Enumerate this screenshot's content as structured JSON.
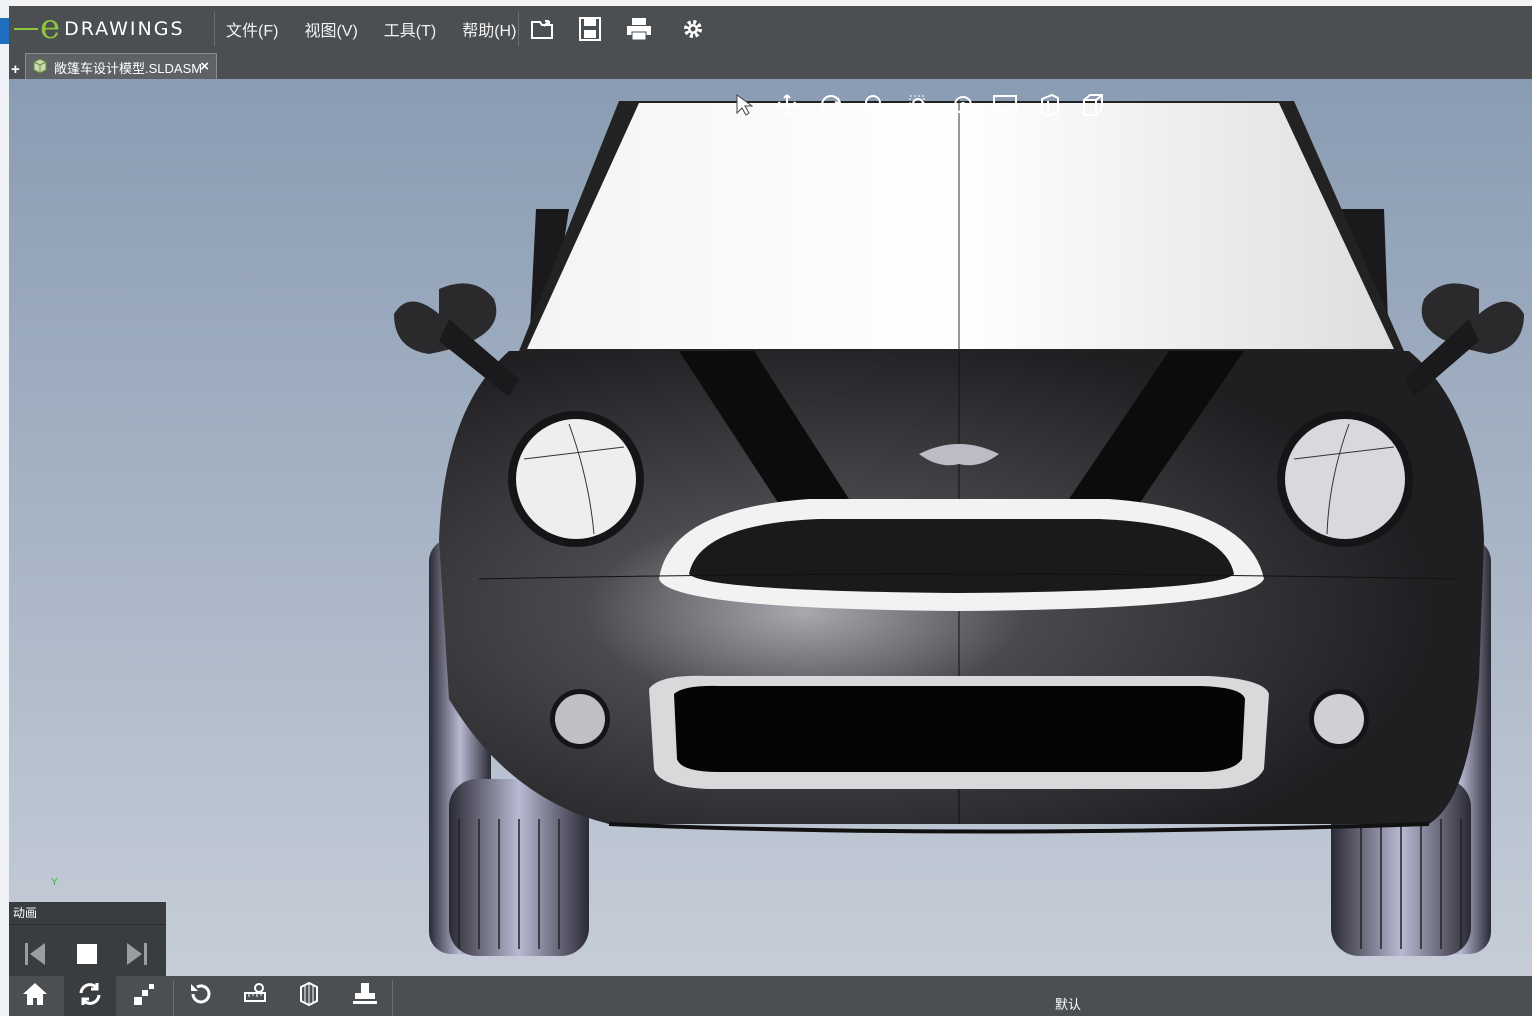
{
  "app": {
    "logo_letter": "e",
    "logo_word": "DRAWINGS"
  },
  "menu": {
    "file": "文件(F)",
    "view": "视图(V)",
    "tools": "工具(T)",
    "help": "帮助(H)"
  },
  "toolbar_icons": [
    "open-folder-icon",
    "save-icon",
    "print-icon",
    "settings-gear-icon"
  ],
  "tab": {
    "plus": "+",
    "label": "敞篷车设计模型.SLDASM",
    "close": "×"
  },
  "headsup_icons": [
    "select-arrow-icon",
    "pan-icon",
    "rotate-icon",
    "zoom-to-fit-icon",
    "zoom-to-area-icon",
    "zoom-icon",
    "display-style-icon",
    "section-view-icon",
    "view-orientation-icon"
  ],
  "triad": {
    "axis_label": "Y"
  },
  "animation": {
    "title": "动画",
    "buttons": [
      "previous-frame-icon",
      "stop-icon",
      "next-frame-icon"
    ]
  },
  "bottom_toolbar": {
    "buttons": [
      "home-icon",
      "rotate-animate-icon",
      "explode-steps-icon",
      "reset-icon",
      "measure-icon",
      "section-icon",
      "stamp-icon"
    ],
    "configuration": "默认"
  },
  "colors": {
    "accent_green": "#8fc43f",
    "chrome_dark": "#4b4f52",
    "viewport_top": "#8a9cb3",
    "viewport_bottom": "#c6cdd8"
  }
}
